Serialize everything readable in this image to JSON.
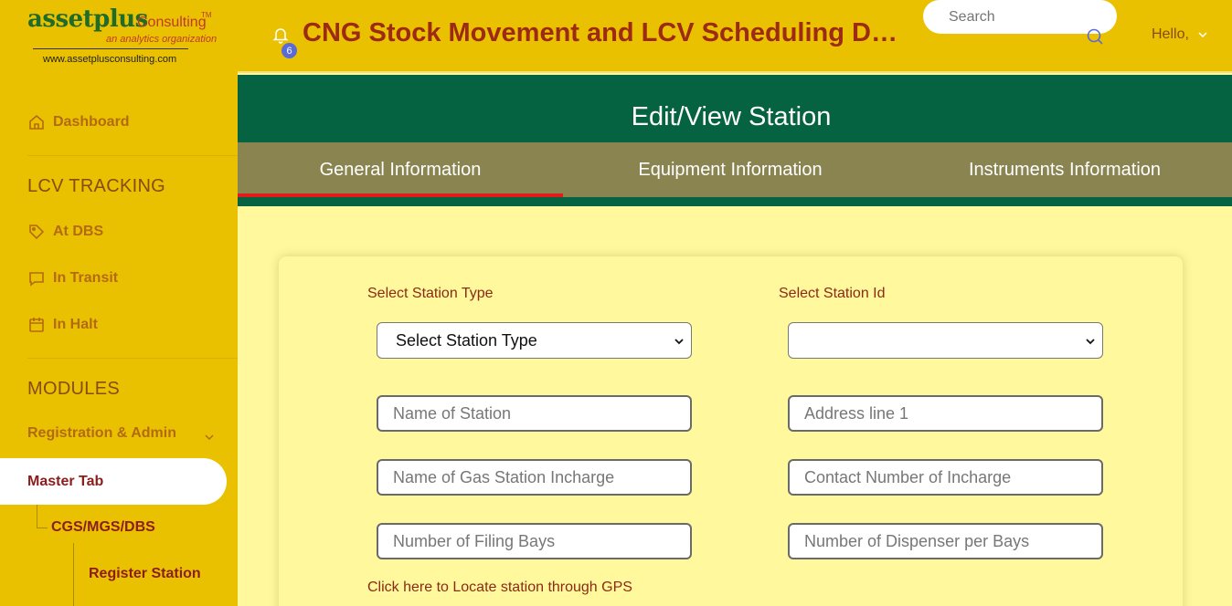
{
  "logo": {
    "brand": "assetplus",
    "consulting": "Consulting",
    "tm": "TM",
    "tagline": "an analytics organization",
    "url": "www.assetplusconsulting.com"
  },
  "sidebar": {
    "dashboard": "Dashboard",
    "lcv_tracking": "LCV TRACKING",
    "at_dbs": "At DBS",
    "in_transit": "In Transit",
    "in_halt": "In Halt",
    "modules": "MODULES",
    "registration_admin": "Registration & Admin",
    "master_tab": "Master Tab",
    "cgs_mgs_dbs": "CGS/MGS/DBS",
    "register_station": "Register Station"
  },
  "header": {
    "notifications_count": "6",
    "title": "CNG Stock Movement and LCV Scheduling Dashboard",
    "search_placeholder": "Search",
    "hello": "Hello,"
  },
  "main": {
    "page_title": "Edit/View Station",
    "tabs": [
      "General Information",
      "Equipment Information",
      "Instruments Information"
    ],
    "active_tab": 0
  },
  "form": {
    "station_type_label": "Select Station Type",
    "station_type_value": "Select Station Type",
    "station_id_label": "Select Station Id",
    "station_id_value": "",
    "name_of_station": "Name of Station",
    "address_line_1": "Address line 1",
    "gas_station_incharge": "Name of Gas Station Incharge",
    "contact_incharge": "Contact Number of Incharge",
    "filling_bays": "Number of Filing Bays",
    "dispenser_per_bays": "Number of Dispenser per Bays",
    "gps_link": "Click here to Locate station through GPS"
  },
  "colors": {
    "sidebar_bg": "#e9c100",
    "banner_green": "#056341",
    "tab_bg": "#8a8450",
    "content_bg": "#fff89c",
    "active_tab_underline": "#e31b1b",
    "title_text": "#9c2a14"
  }
}
